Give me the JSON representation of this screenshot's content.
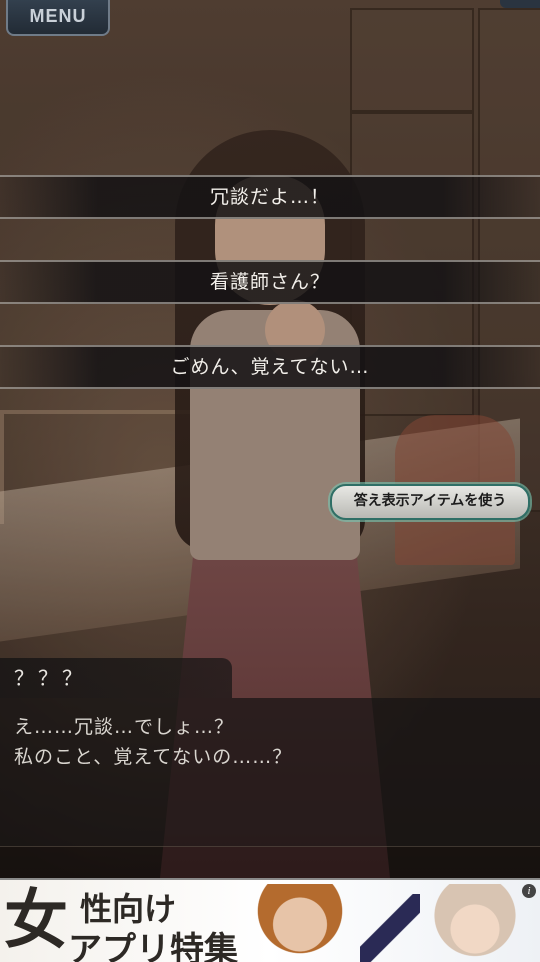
{
  "menu": {
    "label": "MENU"
  },
  "choices": [
    {
      "label": "冗談だよ…！"
    },
    {
      "label": "看護師さん？"
    },
    {
      "label": "ごめん、覚えてない…"
    }
  ],
  "hint_button": {
    "label": "答え表示アイテムを使う"
  },
  "message": {
    "speaker": "？？？",
    "lines": [
      "え……冗談…でしょ…？",
      "私のこと、覚えてないの……？"
    ]
  },
  "ad": {
    "big_char": "女",
    "line1": "性向け",
    "line2": "アプリ特集",
    "info_icon": "info-icon"
  }
}
